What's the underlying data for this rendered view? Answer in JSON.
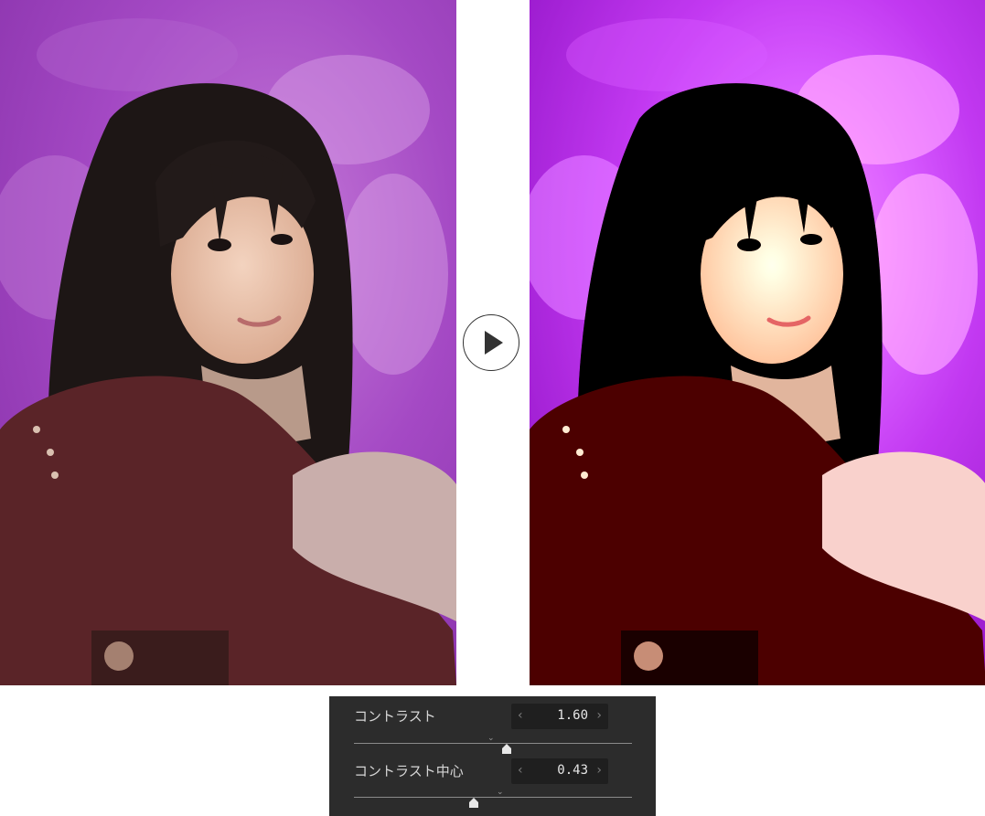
{
  "comparison": {
    "arrow_icon": "play-arrow-icon"
  },
  "adjust_panel": {
    "contrast": {
      "label": "コントラスト",
      "value": "1.60",
      "value_fraction": 0.55
    },
    "contrast_center": {
      "label": "コントラスト中心",
      "value": "0.43",
      "value_fraction": 0.43
    },
    "decrement_icon": "chevron-left-icon",
    "increment_icon": "chevron-right-icon",
    "default_marker_icon": "chevron-down-icon",
    "thumb_icon": "slider-thumb-icon"
  },
  "colors": {
    "panel_bg": "#2c2c2c",
    "field_bg": "#1f1f1f",
    "backdrop_purple": "#9a3fbf",
    "sweater": "#5a2428"
  }
}
